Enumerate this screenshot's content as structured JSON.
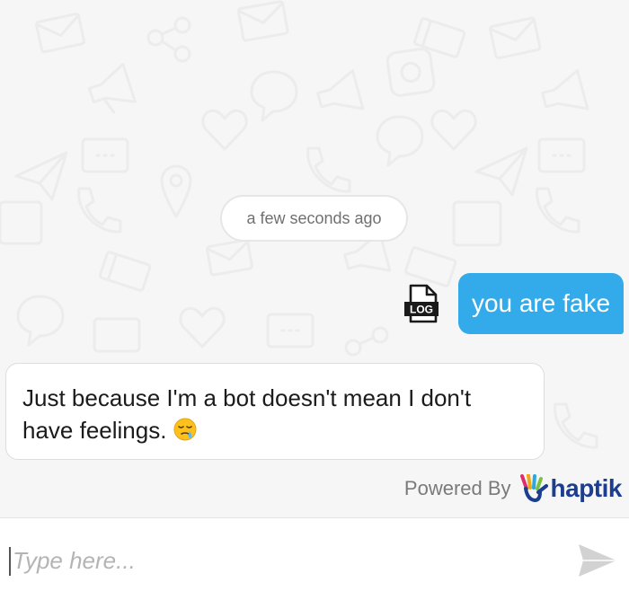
{
  "chat": {
    "timestamp": "a few seconds ago",
    "user_message": "you are fake",
    "user_attachment_icon": "log-file-icon",
    "user_attachment_label": "LOG",
    "bot_message": "Just because I'm a bot doesn't mean I don't have feelings.",
    "bot_emoji": "sleepy-face"
  },
  "branding": {
    "powered_by": "Powered By",
    "brand_name": "haptik"
  },
  "composer": {
    "placeholder": "Type here...",
    "value": "",
    "send_icon": "send-icon"
  },
  "colors": {
    "user_bubble": "#33aaea",
    "brand": "#1d3d90",
    "background": "#f6f6f6"
  }
}
